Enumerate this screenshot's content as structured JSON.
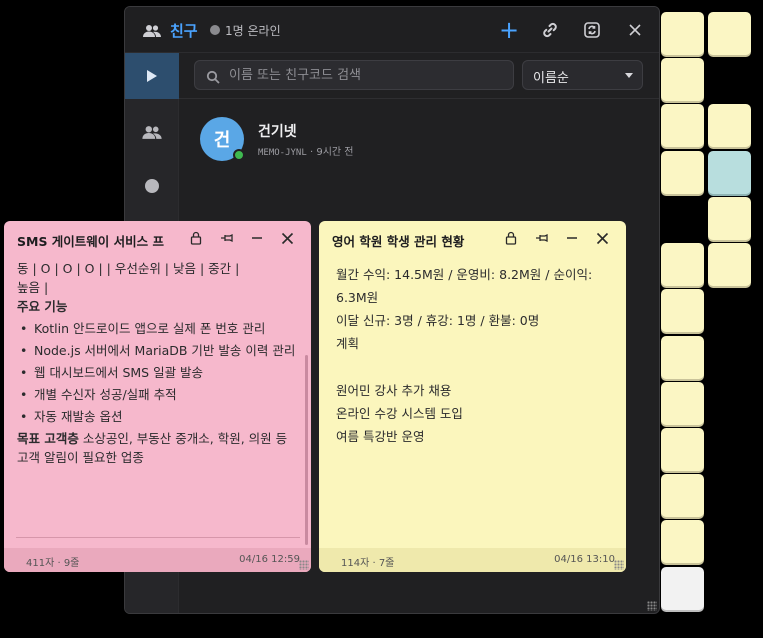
{
  "friends_window": {
    "title": "친구",
    "online_status": "1명 온라인",
    "search_placeholder": "이름 또는 친구코드 검색",
    "sort_selected": "이름순",
    "friend": {
      "avatar_letter": "건",
      "name": "건기넷",
      "code": "MEMO-JYNL",
      "last_seen": "· 9시간 전",
      "avatar_color": "#5aa7e6"
    },
    "accent": "#4aa3ff"
  },
  "notes": [
    {
      "title": "SMS 게이트웨이 서비스 프",
      "color": "#f6b8cc",
      "line1": "동 | O | O | O | | 우선순위 | 낮음 | 중간 |",
      "line2": "높음 |",
      "heading": "주요 기능",
      "features": [
        "Kotlin 안드로이드 앱으로 실제 폰 번호 관리",
        "Node.js 서버에서 MariaDB 기반 발송 이력 관리",
        "웹 대시보드에서 SMS 일괄 발송",
        "개별 수신자 성공/실패 추적",
        "자동 재발송 옵션"
      ],
      "target_label": "목표 고객층",
      "target_text": " 소상공인, 부동산 중개소, 학원, 의원 등 고객 알림이 필요한 업종",
      "footer_count": "411자 · 9줄",
      "footer_date": "04/16 12:59"
    },
    {
      "title": "영어 학원 학생 관리 현황",
      "color": "#fbf6bd",
      "lines": [
        "월간 수익: 14.5M원 / 운영비: 8.2M원 / 순이익: 6.3M원",
        "이달 신규: 3명 / 휴강: 1명 / 환불: 0명",
        "계획",
        "",
        "원어민 강사 추가 채용",
        "온라인 수강 시스템 도입",
        "여름 특강반 운영"
      ],
      "footer_count": "114자 · 7줄",
      "footer_date": "04/16 13:10"
    }
  ],
  "mini_note_colors": {
    "yellow": "#fbf6c4",
    "teal": "#b8dede",
    "white": "#f2f2f2"
  }
}
